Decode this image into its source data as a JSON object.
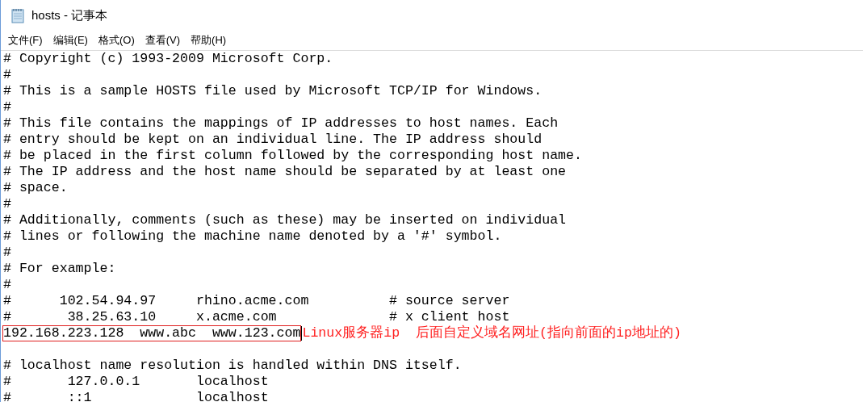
{
  "window": {
    "title": "hosts - 记事本"
  },
  "menu": [
    {
      "label": "文件(F)"
    },
    {
      "label": "编辑(E)"
    },
    {
      "label": "格式(O)"
    },
    {
      "label": "查看(V)"
    },
    {
      "label": "帮助(H)"
    }
  ],
  "editor": {
    "lines": [
      {
        "text": "# Copyright (c) 1993-2009 Microsoft Corp.",
        "highlighted": false
      },
      {
        "text": "#",
        "highlighted": false
      },
      {
        "text": "# This is a sample HOSTS file used by Microsoft TCP/IP for Windows.",
        "highlighted": false
      },
      {
        "text": "#",
        "highlighted": false
      },
      {
        "text": "# This file contains the mappings of IP addresses to host names. Each",
        "highlighted": false
      },
      {
        "text": "# entry should be kept on an individual line. The IP address should",
        "highlighted": false
      },
      {
        "text": "# be placed in the first column followed by the corresponding host name.",
        "highlighted": false
      },
      {
        "text": "# The IP address and the host name should be separated by at least one",
        "highlighted": false
      },
      {
        "text": "# space.",
        "highlighted": false
      },
      {
        "text": "#",
        "highlighted": false
      },
      {
        "text": "# Additionally, comments (such as these) may be inserted on individual",
        "highlighted": false
      },
      {
        "text": "# lines or following the machine name denoted by a '#' symbol.",
        "highlighted": false
      },
      {
        "text": "#",
        "highlighted": false
      },
      {
        "text": "# For example:",
        "highlighted": false
      },
      {
        "text": "#",
        "highlighted": false
      },
      {
        "text": "#      102.54.94.97     rhino.acme.com          # source server",
        "highlighted": false
      },
      {
        "text": "#       38.25.63.10     x.acme.com              # x client host",
        "highlighted": false
      },
      {
        "text": "192.168.223.128  www.abc  www.123.com",
        "highlighted": true,
        "note": "Linux服务器ip  后面自定义域名网址(指向前面的ip地址的)"
      },
      {
        "highlighted": false
      },
      {
        "text": "# localhost name resolution is handled within DNS itself.",
        "highlighted": false
      },
      {
        "text": "#       127.0.0.1       localhost",
        "highlighted": false
      },
      {
        "text": "#       ::1             localhost",
        "highlighted": false
      }
    ]
  }
}
